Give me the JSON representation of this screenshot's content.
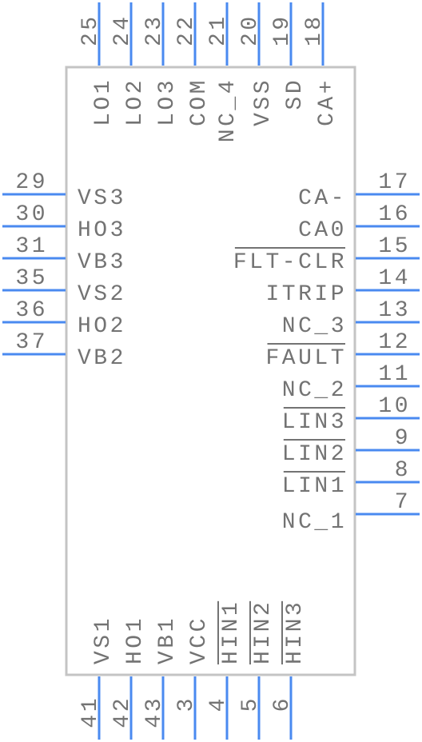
{
  "component": {
    "colors": {
      "pin": "#4a8af0",
      "body": "#c4c4c4",
      "text": "#737373"
    },
    "pins": {
      "top": [
        {
          "number": "25",
          "name": "LO1",
          "overline": false
        },
        {
          "number": "24",
          "name": "LO2",
          "overline": false
        },
        {
          "number": "23",
          "name": "LO3",
          "overline": false
        },
        {
          "number": "22",
          "name": "COM",
          "overline": false
        },
        {
          "number": "21",
          "name": "NC_4",
          "overline": false
        },
        {
          "number": "20",
          "name": "VSS",
          "overline": false
        },
        {
          "number": "19",
          "name": "SD",
          "overline": false
        },
        {
          "number": "18",
          "name": "CA+",
          "overline": false
        }
      ],
      "left": [
        {
          "number": "29",
          "name": "VS3",
          "overline": false
        },
        {
          "number": "30",
          "name": "HO3",
          "overline": false
        },
        {
          "number": "31",
          "name": "VB3",
          "overline": false
        },
        {
          "number": "35",
          "name": "VS2",
          "overline": false
        },
        {
          "number": "36",
          "name": "HO2",
          "overline": false
        },
        {
          "number": "37",
          "name": "VB2",
          "overline": false
        }
      ],
      "right": [
        {
          "number": "17",
          "name": "CA-",
          "overline": false
        },
        {
          "number": "16",
          "name": "CA0",
          "overline": false
        },
        {
          "number": "15",
          "name": "FLT-CLR",
          "overline": true
        },
        {
          "number": "14",
          "name": "ITRIP",
          "overline": false
        },
        {
          "number": "13",
          "name": "NC_3",
          "overline": false
        },
        {
          "number": "12",
          "name": "FAULT",
          "overline": true
        },
        {
          "number": "11",
          "name": "NC_2",
          "overline": false
        },
        {
          "number": "10",
          "name": "LIN3",
          "overline": true
        },
        {
          "number": "9",
          "name": "LIN2",
          "overline": true
        },
        {
          "number": "8",
          "name": "LIN1",
          "overline": true
        },
        {
          "number": "7",
          "name": "NC_1",
          "overline": false
        }
      ],
      "bottom": [
        {
          "number": "41",
          "name": "VS1",
          "overline": false
        },
        {
          "number": "42",
          "name": "HO1",
          "overline": false
        },
        {
          "number": "43",
          "name": "VB1",
          "overline": false
        },
        {
          "number": "3",
          "name": "VCC",
          "overline": false
        },
        {
          "number": "4",
          "name": "HIN1",
          "overline": true
        },
        {
          "number": "5",
          "name": "HIN2",
          "overline": true
        },
        {
          "number": "6",
          "name": "HIN3",
          "overline": true
        }
      ]
    }
  }
}
